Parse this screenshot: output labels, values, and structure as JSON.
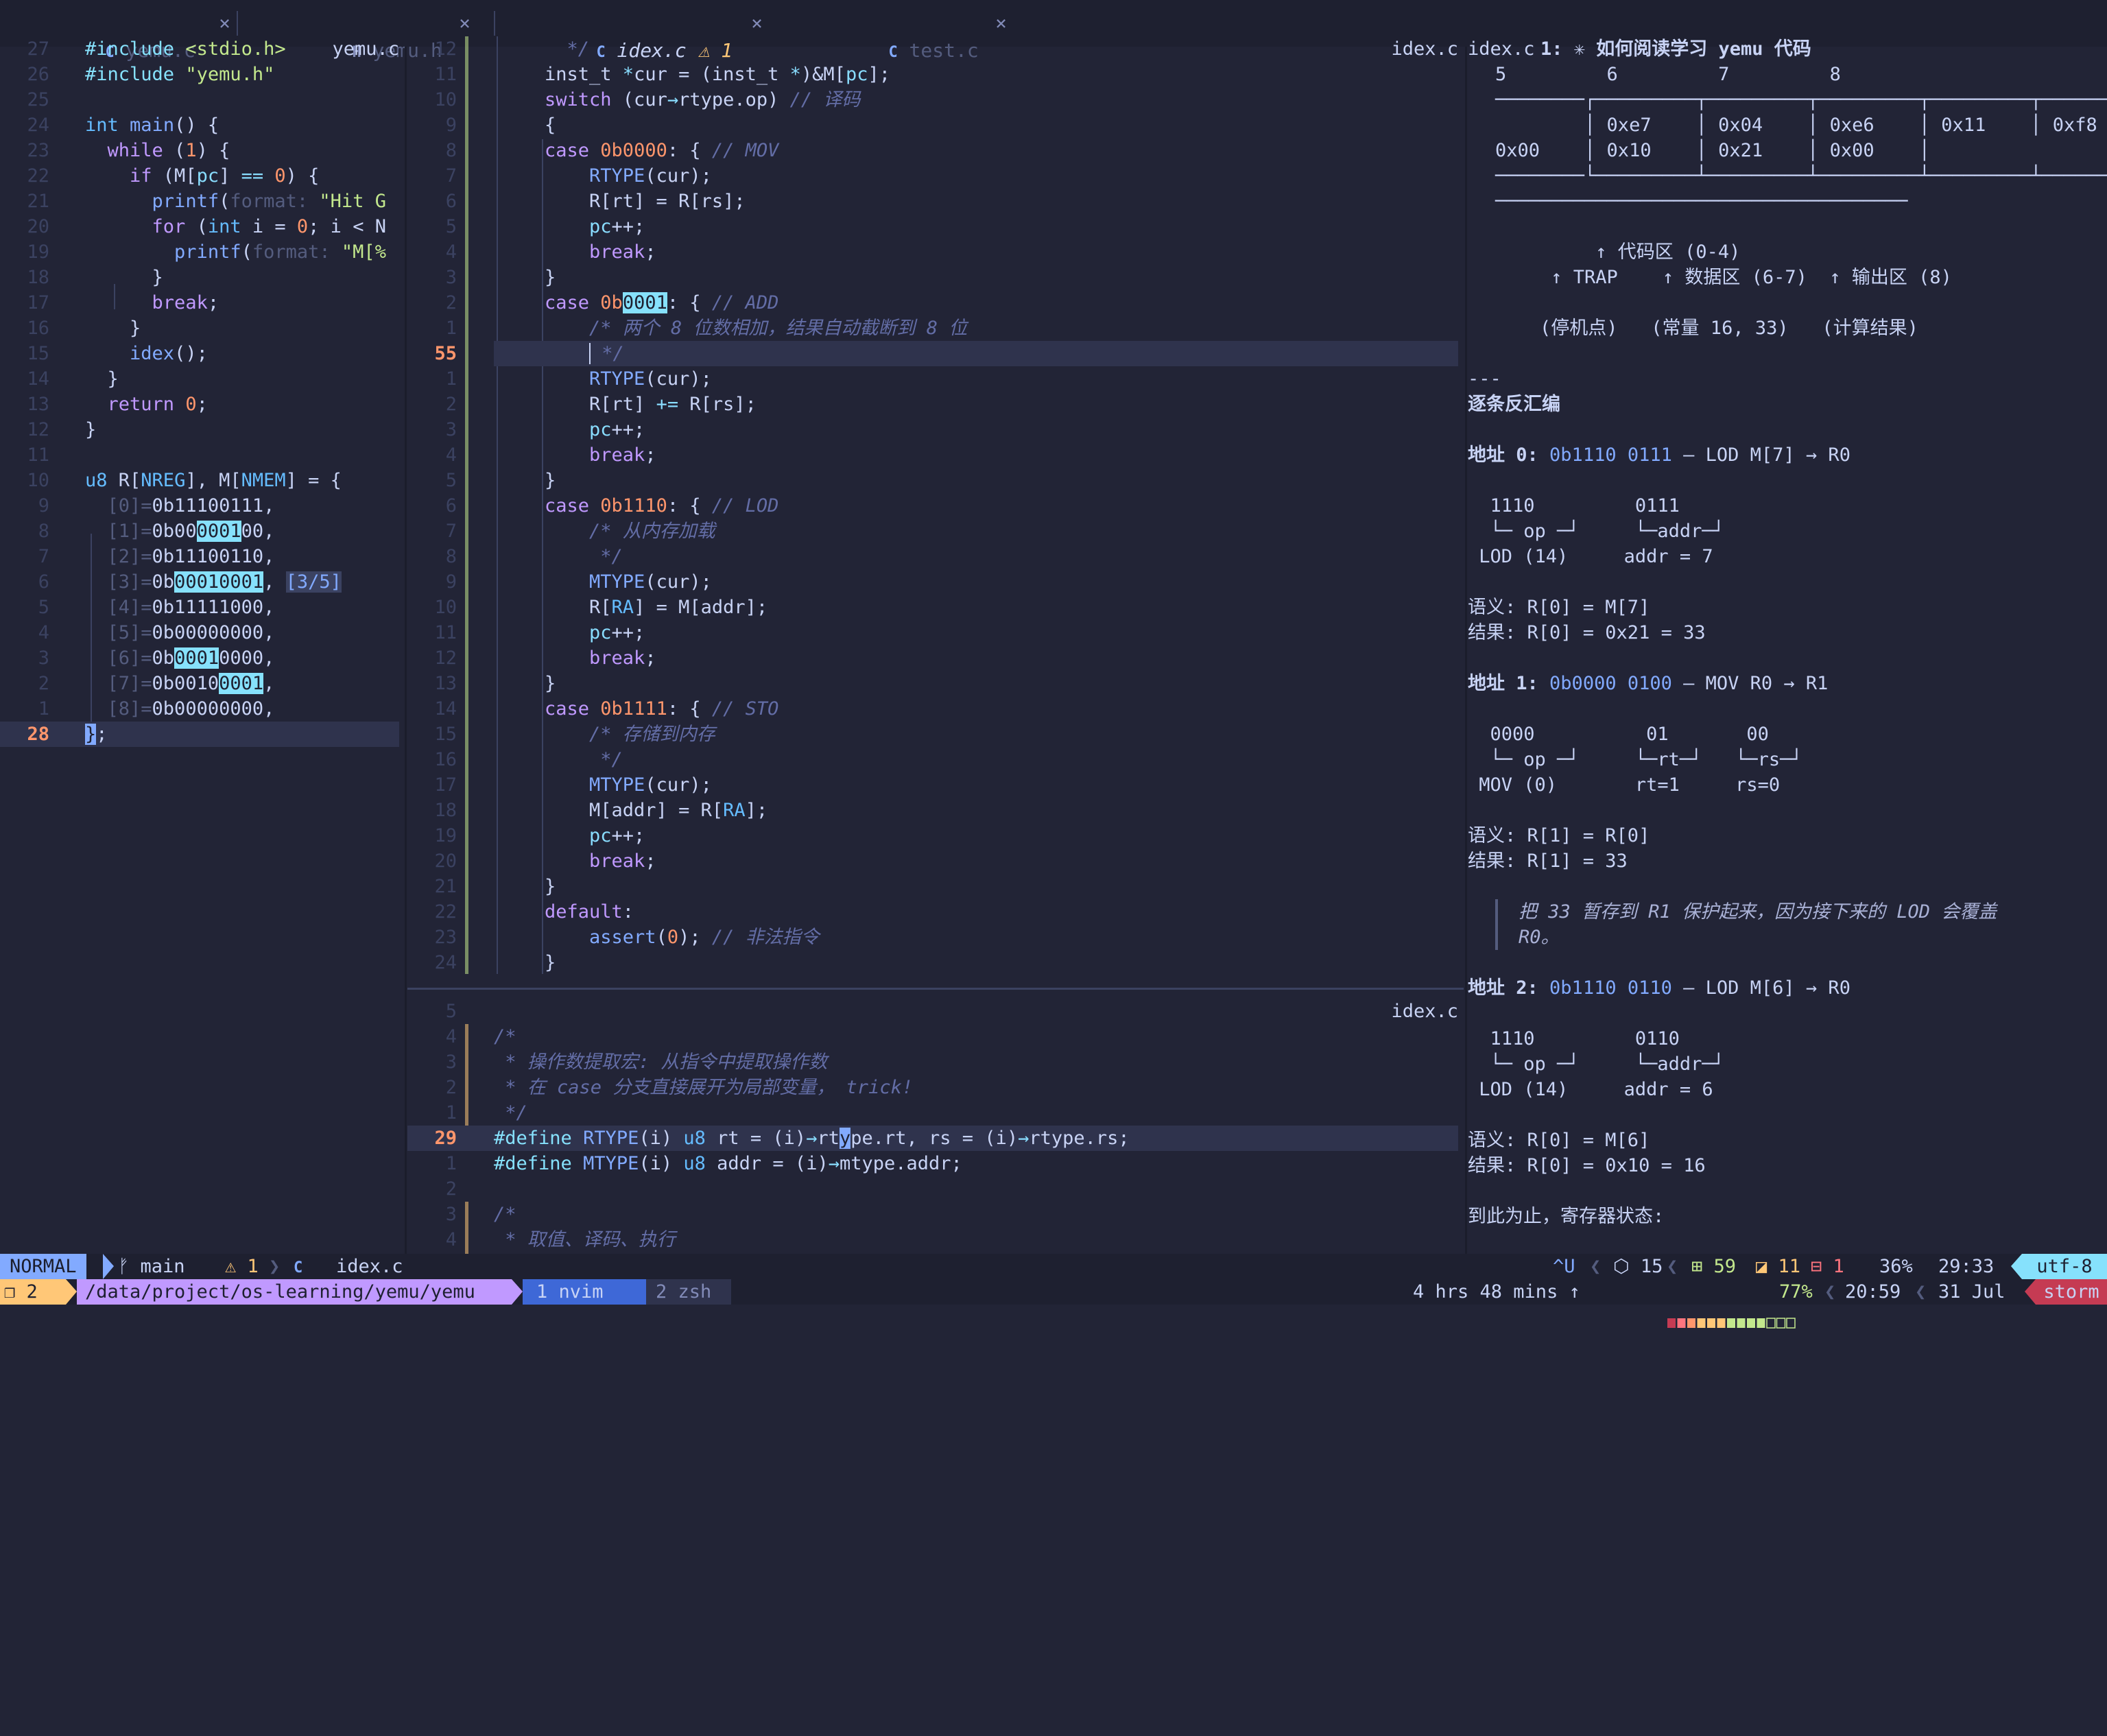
{
  "tabs": [
    {
      "icon": "C",
      "label": "yemu.c",
      "close": "×"
    },
    {
      "icon": "H",
      "label": "yemu.h",
      "close": "×"
    },
    {
      "icon": "C",
      "label": "idex.c",
      "warn": "⚠ 1",
      "close": "×"
    },
    {
      "icon": "C",
      "label": "test.c",
      "close": "×"
    }
  ],
  "left_pane": {
    "file_label": "yemu.c",
    "lines": [
      {
        "n": "27"
      },
      {
        "n": "26"
      },
      {
        "n": "25"
      },
      {
        "n": "24"
      },
      {
        "n": "23"
      },
      {
        "n": "22"
      },
      {
        "n": "21"
      },
      {
        "n": "20"
      },
      {
        "n": "19"
      },
      {
        "n": "18"
      },
      {
        "n": "17"
      },
      {
        "n": "16"
      },
      {
        "n": "15"
      },
      {
        "n": "14"
      },
      {
        "n": "13"
      },
      {
        "n": "12"
      },
      {
        "n": "11"
      },
      {
        "n": "10"
      },
      {
        "n": "9"
      },
      {
        "n": "8"
      },
      {
        "n": "7"
      },
      {
        "n": "6"
      },
      {
        "n": "5"
      },
      {
        "n": "4"
      },
      {
        "n": "3"
      },
      {
        "n": "2"
      },
      {
        "n": "1"
      },
      {
        "n": "28"
      }
    ],
    "search_count": "[3/5]"
  },
  "mid_top": {
    "file_label": "idex.c",
    "lines": [
      "12",
      "11",
      "10",
      "9",
      "8",
      "7",
      "6",
      "5",
      "4",
      "3",
      "2",
      "1",
      "55",
      "1",
      "2",
      "3",
      "4",
      "5",
      "6",
      "7",
      "8",
      "9",
      "10",
      "11",
      "12",
      "13",
      "14",
      "15",
      "16",
      "17",
      "18",
      "19",
      "20",
      "21",
      "22",
      "23",
      "24"
    ]
  },
  "mid_bottom": {
    "file_label": "idex.c",
    "lines": [
      "5",
      "4",
      "3",
      "2",
      "1",
      "29",
      "1",
      "2",
      "3",
      "4"
    ]
  },
  "right_pane": {
    "file_label": "idex.c",
    "title": "1: ✳ 如何阅读学习 yemu 代码",
    "diagram_lines": [
      "5         6         7         8",
      "────────┌─────────┬─────────┬─────────┬─────────┬──────",
      "        │ 0xe7    │ 0x04    │ 0xe6    │ 0x11    │ 0xf8    │",
      "0x00    │ 0x10    │ 0x21    │ 0x00    │",
      "────────└─────────┴─────────┴─────────┴─────────┴──────",
      "─────────────────────────────────────",
      "",
      "         ↑ 代码区 (0-4)",
      "     ↑ TRAP    ↑ 数据区 (6-7)  ↑ 输出区 (8)",
      "",
      "    (停机点)   (常量 16, 33)   (计算结果)",
      "",
      "---"
    ],
    "section_title": "逐条反汇编",
    "entries": [
      {
        "addr_label": "地址 0:",
        "bits": "0b1110 0111",
        "rest": " — LOD M[7] → R0",
        "fields": [
          "  1110         0111",
          "  └─ op ─┘     └─addr─┘",
          " LOD (14)     addr = 7"
        ],
        "sem": "语义: R[0] = M[7]",
        "res": "结果: R[0] = 0x21 = 33"
      },
      {
        "addr_label": "地址 1:",
        "bits": "0b0000 0100",
        "rest": " — MOV R0 → R1",
        "fields": [
          "  0000          01       00",
          "  └─ op ─┘     └─rt─┘   └─rs─┘",
          " MOV (0)       rt=1     rs=0"
        ],
        "sem": "语义: R[1] = R[0]",
        "res": "结果: R[1] = 33"
      },
      {
        "addr_label": "地址 2:",
        "bits": "0b1110 0110",
        "rest": " — LOD M[6] → R0",
        "fields": [
          "  1110         0110",
          "  └─ op ─┘     └─addr─┘",
          " LOD (14)     addr = 6"
        ],
        "sem": "语义: R[0] = M[6]",
        "res": "结果: R[0] = 0x10 = 16"
      }
    ],
    "quote": [
      "把 33 暂存到 R1 保护起来，因为接下来的 LOD 会覆盖",
      "R0。"
    ],
    "tail": "到此为止，寄存器状态:"
  },
  "statusline": {
    "mode": "NORMAL",
    "branch": "main",
    "branch_icon": "",
    "warn": "⚠ 1",
    "file_icon": "C",
    "file": "idex.c",
    "u": "^U",
    "pkg": "15",
    "added": "59",
    "changed": "11",
    "removed": "1",
    "percent": "36%",
    "pos": "29:33",
    "enc": "utf-8"
  },
  "tmux": {
    "session": "2",
    "path": "/data/project/os-learning/yemu/yemu",
    "win1": "1 nvim",
    "win2": "2 zsh",
    "uptime": "4 hrs 48 mins ↑",
    "battery_pct": 0.77,
    "battery": "77%",
    "time": "20:59",
    "date": "31 Jul",
    "host": "storm"
  },
  "colors": {
    "bg": "#222436",
    "accent": "#82aaff",
    "keyword": "#c099ff",
    "string": "#c3e88d",
    "number": "#ff966c",
    "comment": "#636da6"
  }
}
